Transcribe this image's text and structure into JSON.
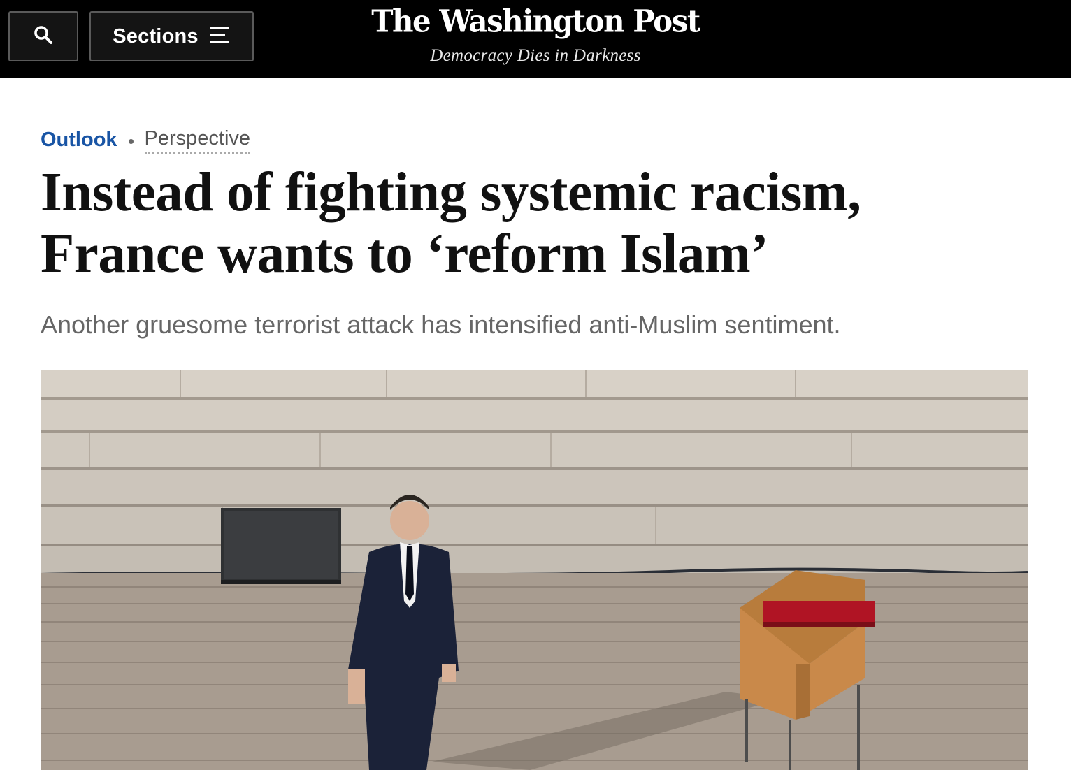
{
  "header": {
    "search_icon": "search-icon",
    "sections_label": "Sections",
    "menu_icon": "hamburger-menu-icon",
    "logo_text": "The Washington Post",
    "tagline": "Democracy Dies in Darkness"
  },
  "article": {
    "section": "Outlook",
    "label": "Perspective",
    "headline": "Instead of fighting systemic racism, France wants to ‘reform Islam’",
    "dek": "Another gruesome terrorist attack has intensified anti-Muslim sentiment."
  },
  "colors": {
    "topbar": "#000000",
    "section_link": "#1955a5",
    "headline": "#111111",
    "dek": "#666666"
  }
}
